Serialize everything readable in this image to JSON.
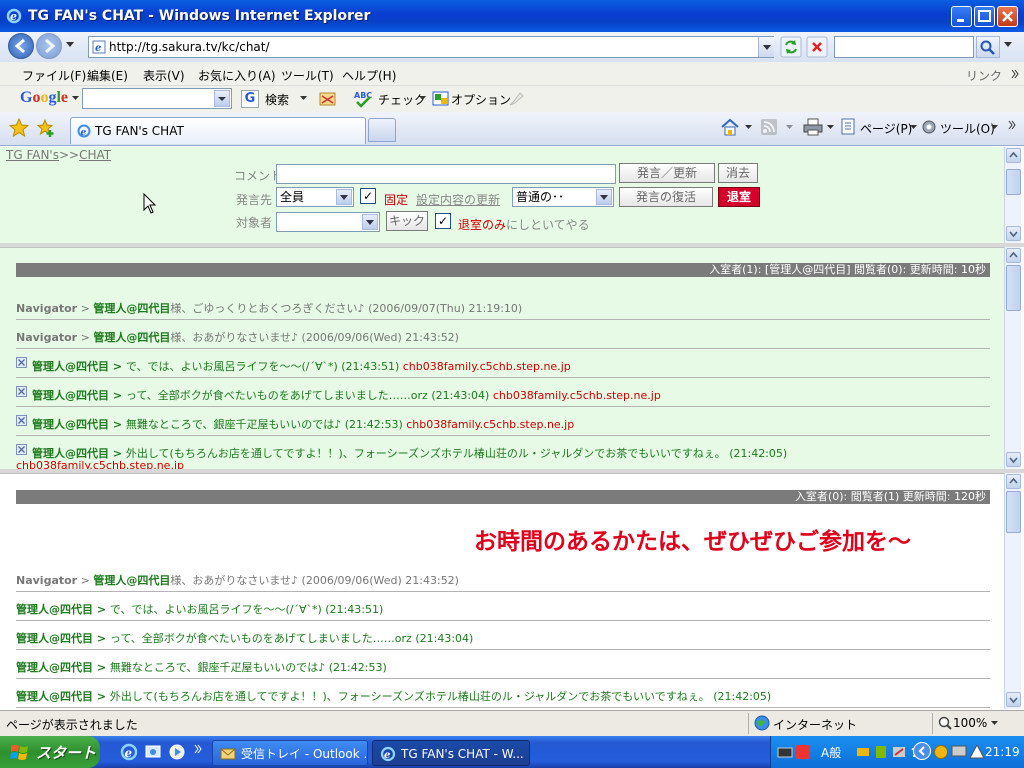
{
  "window": {
    "title": "TG FAN's CHAT - Windows Internet Explorer"
  },
  "address": {
    "url": "http://tg.sakura.tv/kc/chat/"
  },
  "menu": {
    "items": [
      "ファイル(F)",
      "編集(E)",
      "表示(V)",
      "お気に入り(A)",
      "ツール(T)",
      "ヘルプ(H)"
    ],
    "links": "リンク"
  },
  "google_toolbar": {
    "logo": "Google",
    "search_label": "検索",
    "check_label": "チェック",
    "options_label": "オプション"
  },
  "tabs": {
    "active_label": "TG FAN's CHAT",
    "page_label": "ページ(P)",
    "tools_label": "ツール(O)"
  },
  "chat_form": {
    "breadcrumb_home": "TG FAN's",
    "breadcrumb_sep": ">>",
    "breadcrumb_current": "CHAT",
    "comment_label": "コメント",
    "submit_label": "発言／更新",
    "clear_label": "消去",
    "dest_label": "発言先",
    "dest_value": "全員",
    "fixed_label": "固定",
    "settings_update_label": "設定内容の更新",
    "tone_value": "普通の･･",
    "restore_label": "発言の復活",
    "leave_label": "退室",
    "target_label": "対象者",
    "kick_label": "キック",
    "leave_only_label_red": "退室のみ",
    "leave_only_label_rest": "にしといてやる"
  },
  "chat_mid": {
    "header": "入室者(1): [管理人@四代目] 閲覧者(0): 更新時間: 10秒",
    "messages": [
      {
        "type": "nav",
        "nav": "Navigator",
        "arrow": " > ",
        "who": "管理人@四代目",
        "text": "様、ごゆっくりとおくつろぎください♪",
        "time": " (2006/09/07(Thu) 21:19:10)",
        "host": ""
      },
      {
        "type": "nav",
        "nav": "Navigator",
        "arrow": " > ",
        "who": "管理人@四代目",
        "text": "様、おあがりなさいませ♪",
        "time": " (2006/09/06(Wed) 21:43:52)",
        "host": ""
      },
      {
        "type": "user",
        "who": "管理人@四代目",
        "arrow": " > ",
        "text": "で、では、よいお風呂ライフを～～(/´∀`*)",
        "time": " (21:43:51) ",
        "host": "chb038family.c5chb.step.ne.jp"
      },
      {
        "type": "user",
        "who": "管理人@四代目",
        "arrow": " > ",
        "text": "って、全部ボクが食べたいものをあげてしまいました……orz",
        "time": " (21:43:04) ",
        "host": "chb038family.c5chb.step.ne.jp"
      },
      {
        "type": "user",
        "who": "管理人@四代目",
        "arrow": " > ",
        "text": "無難なところで、銀座千疋屋もいいのでは♪",
        "time": " (21:42:53) ",
        "host": "chb038family.c5chb.step.ne.jp"
      },
      {
        "type": "user",
        "who": "管理人@四代目",
        "arrow": " > ",
        "text": "外出して(もちろんお店を通してですよ！！)、フォーシーズンズホテル椿山荘のル・ジャルダンでお茶でもいいですねぇ。",
        "time": " (21:42:05)",
        "host": "chb038family.c5chb.step.ne.jp"
      }
    ]
  },
  "chat_bot": {
    "header": "入室者(0): 閲覧者(1) 更新時間: 120秒",
    "banner": "お時間のあるかたは、ぜひぜひご参加を～",
    "messages": [
      {
        "type": "nav",
        "nav": "Navigator",
        "arrow": " > ",
        "who": "管理人@四代目",
        "text": "様、おあがりなさいませ♪",
        "time": " (2006/09/06(Wed) 21:43:52)"
      },
      {
        "type": "user",
        "who": "管理人@四代目",
        "arrow": " > ",
        "text": "で、では、よいお風呂ライフを～～(/´∀`*)",
        "time": " (21:43:51)"
      },
      {
        "type": "user",
        "who": "管理人@四代目",
        "arrow": " > ",
        "text": "って、全部ボクが食べたいものをあげてしまいました……orz",
        "time": " (21:43:04)"
      },
      {
        "type": "user",
        "who": "管理人@四代目",
        "arrow": " > ",
        "text": "無難なところで、銀座千疋屋もいいのでは♪",
        "time": " (21:42:53)"
      },
      {
        "type": "user",
        "who": "管理人@四代目",
        "arrow": " > ",
        "text": "外出して(もちろんお店を通してですよ！！)、フォーシーズンズホテル椿山荘のル・ジャルダンでお茶でもいいですねぇ。",
        "time": " (21:42:05)"
      }
    ]
  },
  "status": {
    "text": "ページが表示されました",
    "zone": "インターネット",
    "zoom": "100%"
  },
  "taskbar": {
    "start": "スタート",
    "task1": "受信トレイ - Outlook ...",
    "task2": "TG FAN's CHAT - W...",
    "ime": "A般",
    "clock": "21:19"
  },
  "colors": {
    "chat_bg": "#e6fae6",
    "name_green": "#1d7a1d",
    "host_red": "#c00000",
    "header_gray": "#7b7b7b",
    "xp_blue": "#245cdb"
  }
}
